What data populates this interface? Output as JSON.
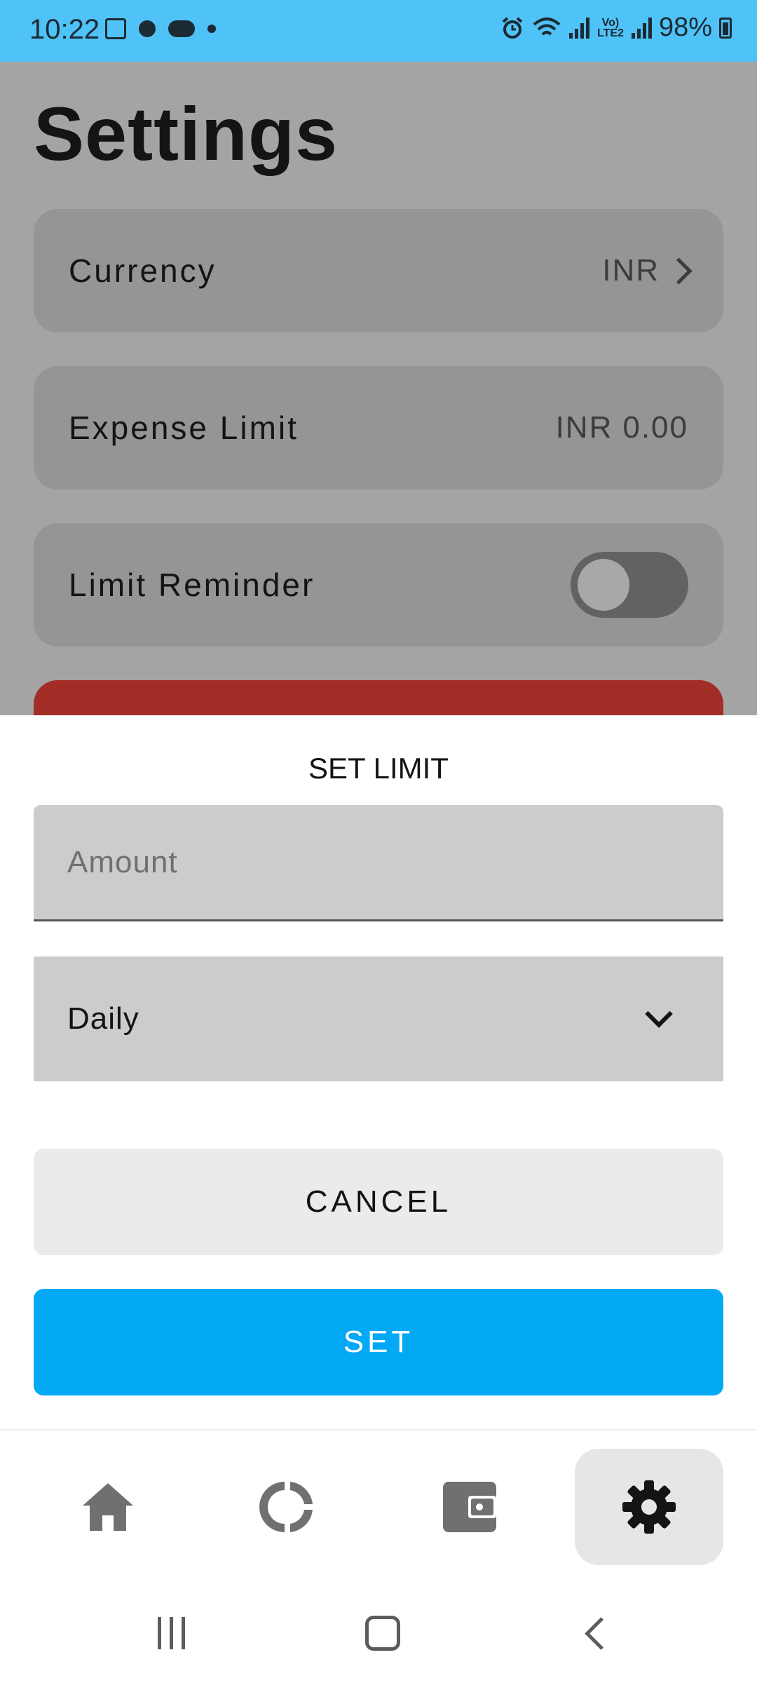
{
  "status_bar": {
    "time": "10:22",
    "battery": "98%",
    "network_label": "Vo) LTE2",
    "icons": [
      "image-icon",
      "notification-icon",
      "media-icon",
      "dot-icon",
      "alarm-icon",
      "wifi-icon",
      "signal-icon",
      "signal-icon",
      "battery-icon"
    ]
  },
  "settings": {
    "title": "Settings",
    "currency": {
      "label": "Currency",
      "value": "INR"
    },
    "expense_limit": {
      "label": "Expense Limit",
      "currency": "INR",
      "amount": "0.00"
    },
    "limit_reminder": {
      "label": "Limit Reminder",
      "enabled": false
    }
  },
  "dialog": {
    "title": "SET LIMIT",
    "amount": {
      "placeholder": "Amount",
      "value": ""
    },
    "period": {
      "selected": "Daily"
    },
    "cancel_label": "CANCEL",
    "set_label": "SET"
  },
  "bottom_nav": {
    "items": [
      {
        "icon": "home-icon",
        "active": false
      },
      {
        "icon": "stats-icon",
        "active": false
      },
      {
        "icon": "wallet-icon",
        "active": false
      },
      {
        "icon": "gear-icon",
        "active": true
      }
    ]
  },
  "colors": {
    "status_bar": "#4fc3f7",
    "accent": "#03a9f4",
    "danger": "#a22d26",
    "scrim": "#a4a4a4"
  }
}
